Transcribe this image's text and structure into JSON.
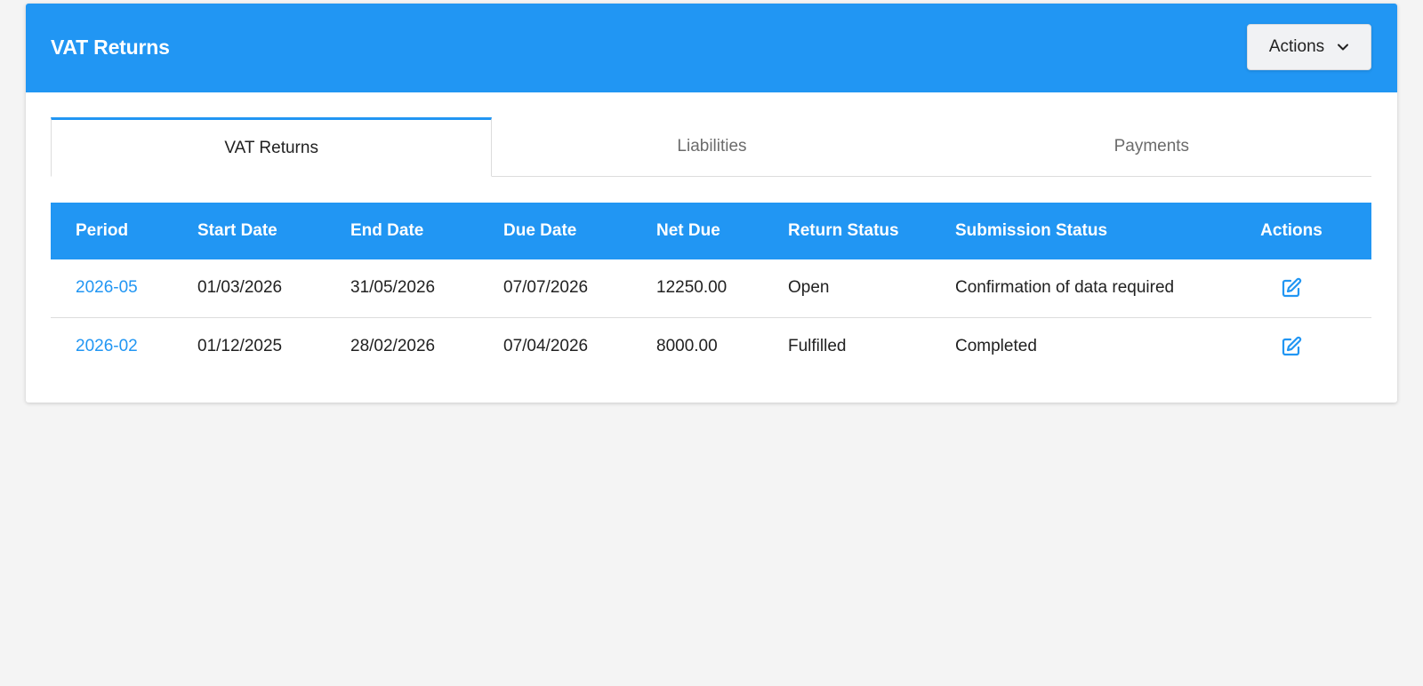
{
  "header": {
    "title": "VAT Returns",
    "actions_label": "Actions",
    "actions_icon": "chevron-down-icon"
  },
  "tabs": [
    {
      "label": "VAT Returns",
      "active": true
    },
    {
      "label": "Liabilities",
      "active": false
    },
    {
      "label": "Payments",
      "active": false
    }
  ],
  "table": {
    "columns": [
      "Period",
      "Start Date",
      "End Date",
      "Due Date",
      "Net Due",
      "Return Status",
      "Submission Status",
      "Actions"
    ],
    "rows": [
      {
        "period": "2026-05",
        "start_date": "01/03/2026",
        "end_date": "31/05/2026",
        "due_date": "07/07/2026",
        "net_due": "12250.00",
        "return_status": "Open",
        "submission_status": "Confirmation of data required",
        "action_icon": "edit-icon"
      },
      {
        "period": "2026-02",
        "start_date": "01/12/2025",
        "end_date": "28/02/2026",
        "due_date": "07/04/2026",
        "net_due": "8000.00",
        "return_status": "Fulfilled",
        "submission_status": "Completed",
        "action_icon": "edit-icon"
      }
    ]
  },
  "colors": {
    "primary": "#2196f3",
    "background": "#f4f4f4",
    "card": "#ffffff"
  }
}
